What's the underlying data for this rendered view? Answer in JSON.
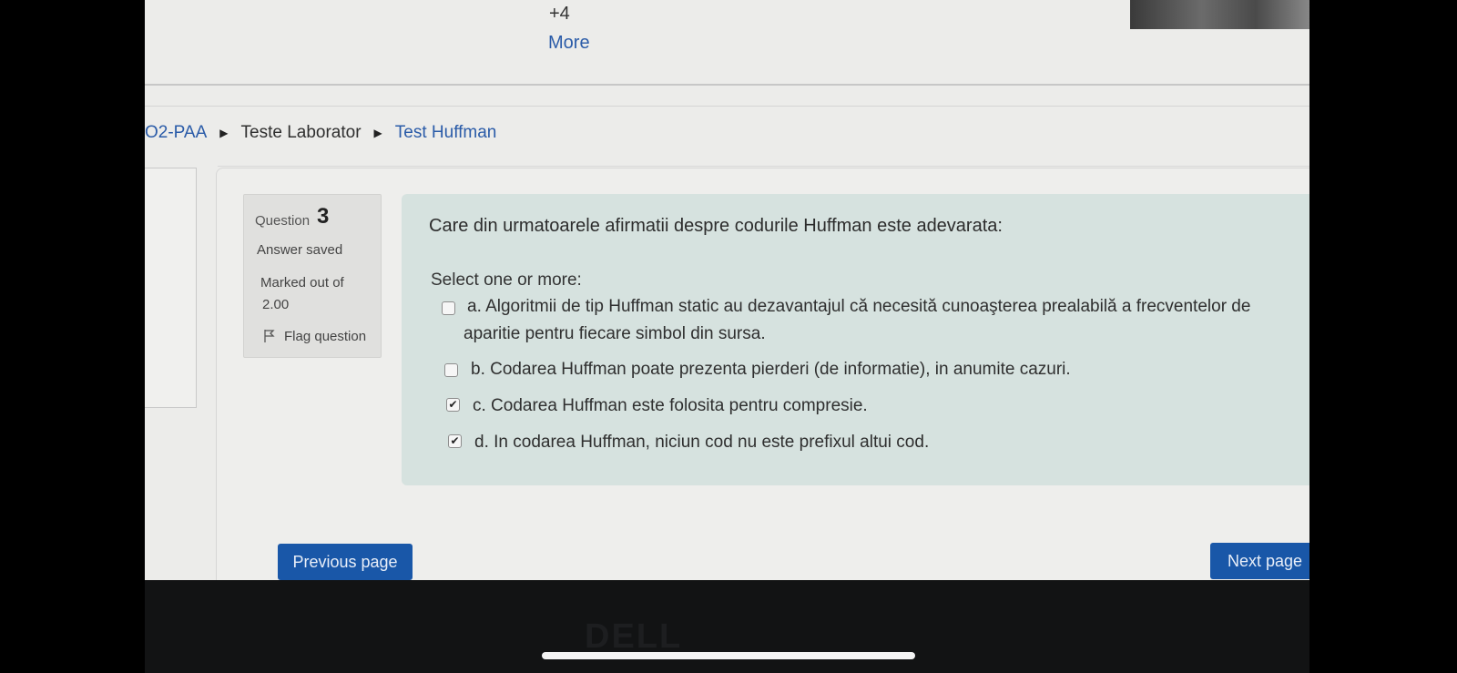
{
  "top": {
    "plus_count": "+4",
    "more_link": "More"
  },
  "breadcrumb": {
    "items": [
      "O2-PAA",
      "Teste Laborator",
      "Test Huffman"
    ]
  },
  "question_info": {
    "label": "Question",
    "number": "3",
    "state": "Answer saved",
    "marked_label": "Marked out of",
    "marked_value": "2.00",
    "flag_label": "Flag question"
  },
  "question": {
    "text": "Care din urmatoarele afirmatii despre codurile Huffman este adevarata:",
    "prompt": "Select one or more:",
    "options": [
      {
        "line1": "a. Algoritmii de tip Huffman static au dezavantajul că necesită cunoaşterea prealabilă a frecventelor de",
        "line2": "aparitie pentru fiecare simbol din sursa.",
        "checked": false
      },
      {
        "line1": "b. Codarea Huffman poate prezenta pierderi (de informatie), in anumite cazuri.",
        "checked": false
      },
      {
        "line1": "c. Codarea Huffman este folosita pentru compresie.",
        "checked": true
      },
      {
        "line1": "d. In codarea Huffman, niciun cod nu este prefixul altui cod.",
        "checked": true
      }
    ]
  },
  "nav": {
    "previous": "Previous page",
    "next": "Next page"
  },
  "device": {
    "logo": "DELL"
  },
  "colors": {
    "link": "#2a5ba8",
    "button": "#1957a8",
    "question_bg": "#d6e2df"
  }
}
